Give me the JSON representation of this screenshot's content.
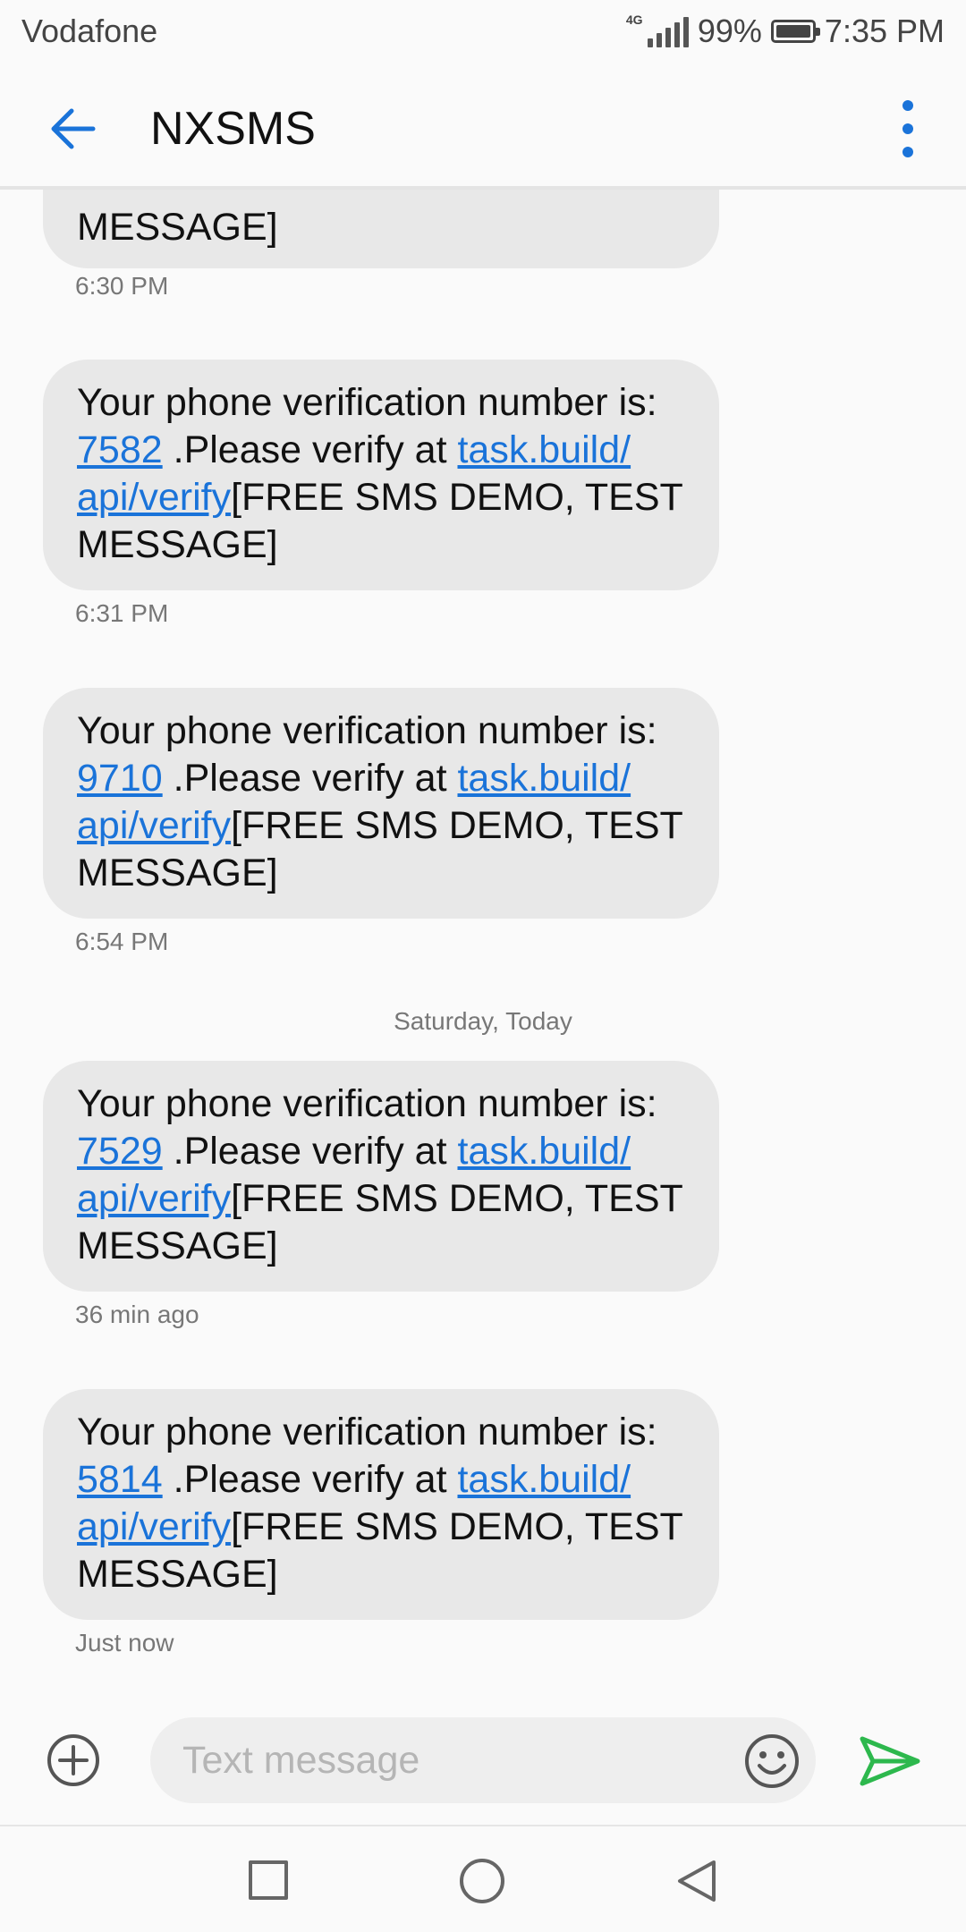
{
  "status_bar": {
    "carrier": "Vodafone",
    "network": "4G",
    "battery": "99%",
    "time": "7:35 PM"
  },
  "app_bar": {
    "title": "NXSMS",
    "back_icon": "arrow-left-icon",
    "menu_icon": "more-vert-icon"
  },
  "conversation": {
    "partial_message": {
      "text": "MESSAGE]",
      "time": "6:30 PM"
    },
    "messages": [
      {
        "prefix": "Your phone verification number is:",
        "code": "7582",
        "middle": " .Please verify at ",
        "link1": "task.build/",
        "link2": "api/verify",
        "suffix": "[FREE SMS DEMO, TEST MESSAGE]",
        "time": "6:31 PM"
      },
      {
        "prefix": "Your phone verification number is:",
        "code": "9710",
        "middle": " .Please verify at ",
        "link1": "task.build/",
        "link2": "api/verify",
        "suffix": "[FREE SMS DEMO, TEST MESSAGE]",
        "time": "6:54 PM"
      },
      {
        "prefix": "Your phone verification number is:",
        "code": "7529",
        "middle": " .Please verify at ",
        "link1": "task.build/",
        "link2": "api/verify",
        "suffix": "[FREE SMS DEMO, TEST MESSAGE]",
        "time": "36 min ago"
      },
      {
        "prefix": "Your phone verification number is:",
        "code": "5814",
        "middle": " .Please verify at ",
        "link1": "task.build/",
        "link2": "api/verify",
        "suffix": "[FREE SMS DEMO, TEST MESSAGE]",
        "time": "Just now"
      }
    ],
    "date_divider": "Saturday, Today"
  },
  "compose": {
    "placeholder": "Text message",
    "value": "",
    "add_icon": "plus-circle-icon",
    "emoji_icon": "smiley-icon",
    "send_icon": "send-icon"
  },
  "nav_bar": {
    "recent_icon": "square-icon",
    "home_icon": "circle-icon",
    "back_icon": "triangle-back-icon"
  },
  "colors": {
    "accent": "#1a73d9",
    "send": "#2db84d",
    "bubble": "#e8e8e8",
    "background": "#fafafa"
  }
}
